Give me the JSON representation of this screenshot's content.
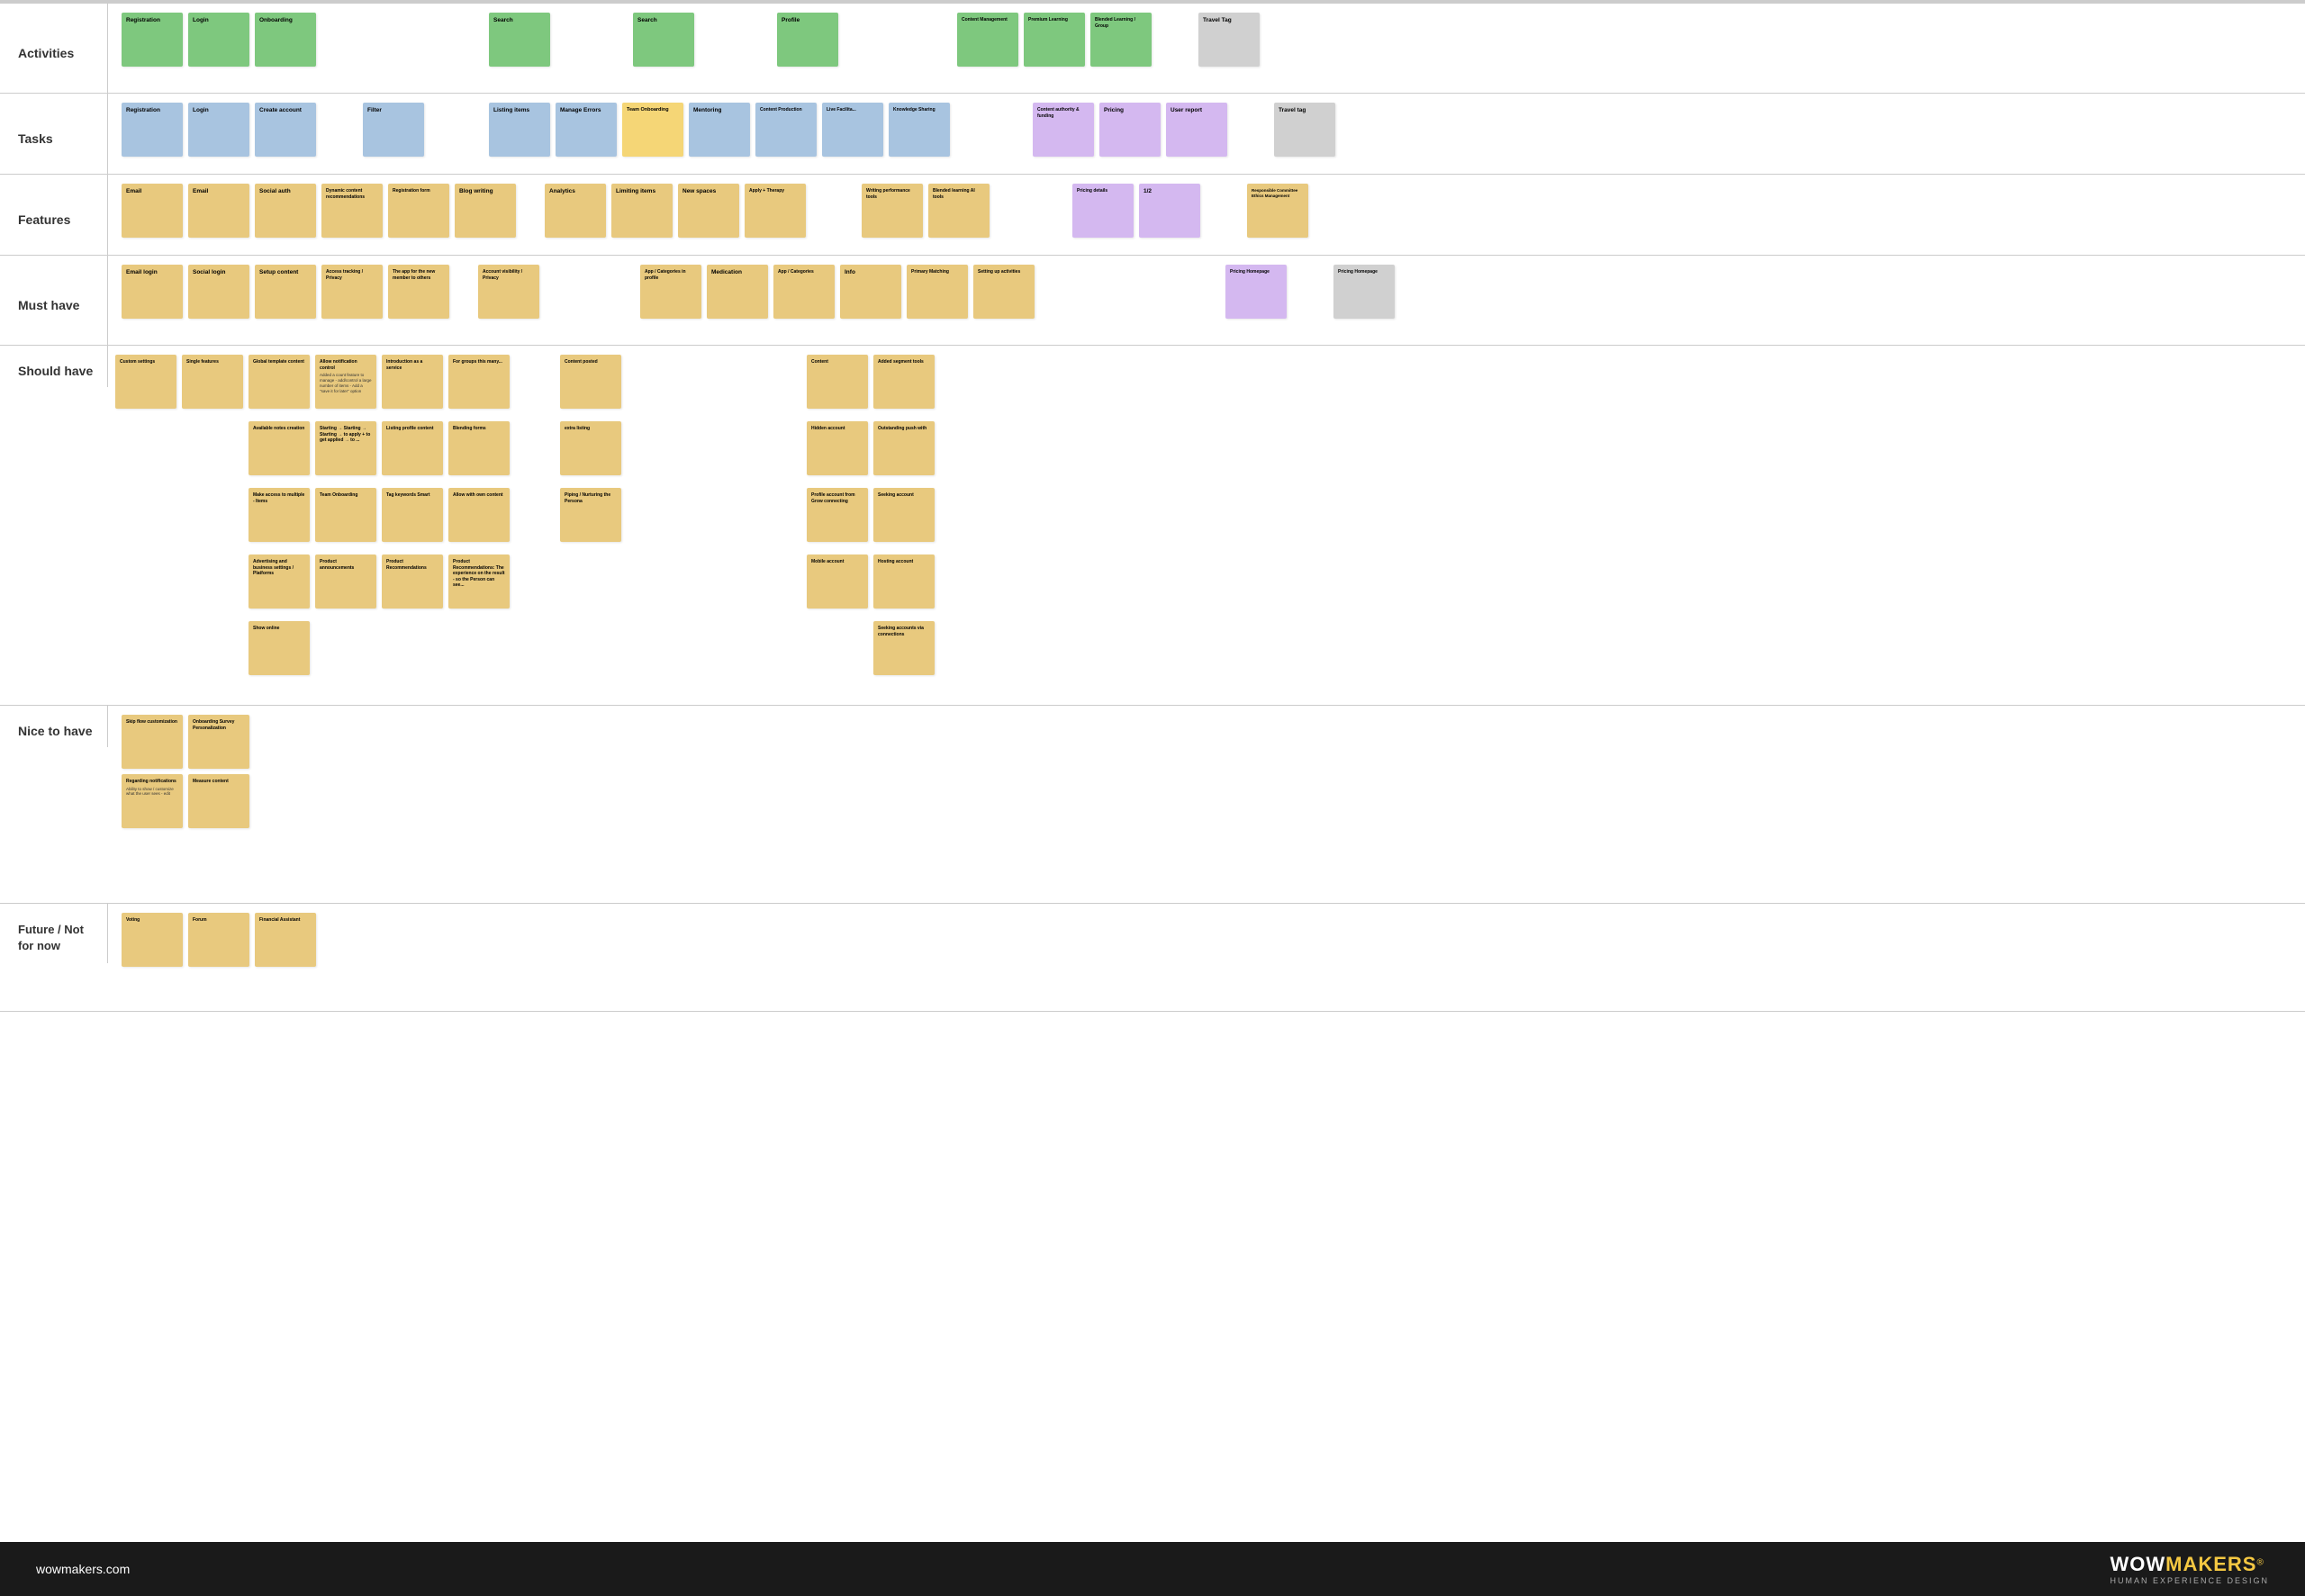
{
  "rows": [
    {
      "id": "activities",
      "label": "Activities",
      "notes": [
        {
          "color": "green",
          "title": "Registration",
          "tag": ""
        },
        {
          "color": "green",
          "title": "Login",
          "tag": ""
        },
        {
          "color": "green",
          "title": "Onboa...",
          "tag": ""
        },
        {
          "color": "",
          "title": "",
          "tag": ""
        },
        {
          "color": "",
          "title": "",
          "tag": ""
        },
        {
          "color": "",
          "title": "",
          "tag": ""
        },
        {
          "color": "",
          "title": "",
          "tag": ""
        },
        {
          "color": "",
          "title": "",
          "tag": ""
        },
        {
          "color": "green",
          "title": "Search",
          "tag": ""
        },
        {
          "color": "",
          "title": "",
          "tag": ""
        },
        {
          "color": "green",
          "title": "Search",
          "tag": ""
        },
        {
          "color": "",
          "title": "",
          "tag": ""
        },
        {
          "color": "green",
          "title": "Profile",
          "tag": ""
        },
        {
          "color": "",
          "title": "",
          "tag": ""
        },
        {
          "color": "",
          "title": "",
          "tag": ""
        },
        {
          "color": "green",
          "title": "Content Management",
          "tag": ""
        },
        {
          "color": "green",
          "title": "Premium Learning",
          "tag": ""
        },
        {
          "color": "green",
          "title": "Blended Learning / Group",
          "tag": ""
        },
        {
          "color": "",
          "title": "",
          "tag": ""
        },
        {
          "color": "gray",
          "title": "Travel Tag",
          "tag": ""
        }
      ]
    },
    {
      "id": "tasks",
      "label": "Tasks",
      "notes": [
        {
          "color": "blue",
          "title": "Registration",
          "tag": ""
        },
        {
          "color": "blue",
          "title": "Login",
          "tag": ""
        },
        {
          "color": "blue",
          "title": "Create account",
          "tag": ""
        },
        {
          "color": "",
          "title": "",
          "tag": ""
        },
        {
          "color": "blue",
          "title": "Filter",
          "tag": ""
        },
        {
          "color": "",
          "title": "",
          "tag": ""
        },
        {
          "color": "blue",
          "title": "Listing items",
          "tag": ""
        },
        {
          "color": "blue",
          "title": "Manage Errors",
          "tag": ""
        },
        {
          "color": "yellow",
          "title": "Team Onboarding",
          "tag": ""
        },
        {
          "color": "blue",
          "title": "Mentoring",
          "tag": ""
        },
        {
          "color": "blue",
          "title": "Content Production",
          "tag": ""
        },
        {
          "color": "blue",
          "title": "Live Facilita...",
          "tag": ""
        },
        {
          "color": "blue",
          "title": "Knowledge Sharing",
          "tag": ""
        },
        {
          "color": "",
          "title": "",
          "tag": ""
        },
        {
          "color": "purple",
          "title": "Content authority & funding",
          "tag": ""
        },
        {
          "color": "purple",
          "title": "Pricing",
          "tag": ""
        },
        {
          "color": "purple",
          "title": "User report",
          "tag": ""
        },
        {
          "color": "",
          "title": "",
          "tag": ""
        },
        {
          "color": "gray",
          "title": "Travel tag",
          "tag": ""
        }
      ]
    },
    {
      "id": "features",
      "label": "Features",
      "notes": [
        {
          "color": "yellow",
          "title": "Email",
          "tag": ""
        },
        {
          "color": "yellow",
          "title": "Email",
          "tag": ""
        },
        {
          "color": "yellow",
          "title": "Social auth",
          "tag": ""
        },
        {
          "color": "yellow",
          "title": "Dynamic content recommendations",
          "tag": ""
        },
        {
          "color": "yellow",
          "title": "Registration form",
          "tag": ""
        },
        {
          "color": "yellow",
          "title": "Blog writing",
          "tag": ""
        },
        {
          "color": "",
          "title": "",
          "tag": ""
        },
        {
          "color": "yellow",
          "title": "Analytics",
          "tag": ""
        },
        {
          "color": "yellow",
          "title": "Limiting items",
          "tag": ""
        },
        {
          "color": "yellow",
          "title": "New spaces",
          "tag": ""
        },
        {
          "color": "yellow",
          "title": "Apply + Therapy",
          "tag": ""
        },
        {
          "color": "",
          "title": "",
          "tag": ""
        },
        {
          "color": "yellow",
          "title": "Writing performance tools",
          "tag": ""
        },
        {
          "color": "yellow",
          "title": "Blended learning AI tools",
          "tag": ""
        },
        {
          "color": "",
          "title": "",
          "tag": ""
        },
        {
          "color": "purple",
          "title": "Pricing details",
          "tag": ""
        },
        {
          "color": "purple",
          "title": "1/2",
          "tag": ""
        },
        {
          "color": "",
          "title": "",
          "tag": ""
        },
        {
          "color": "yellow",
          "title": "Responsible Committee Ethics Management...",
          "tag": ""
        }
      ]
    },
    {
      "id": "musthave",
      "label": "Must have",
      "notes": [
        {
          "color": "yellow",
          "title": "Email login",
          "tag": ""
        },
        {
          "color": "yellow",
          "title": "Social login",
          "tag": ""
        },
        {
          "color": "yellow",
          "title": "Setup content",
          "tag": ""
        },
        {
          "color": "yellow",
          "title": "Access tracking / Privacy",
          "tag": ""
        },
        {
          "color": "yellow",
          "title": "The app for the new member to others",
          "tag": ""
        },
        {
          "color": "",
          "title": "",
          "tag": ""
        },
        {
          "color": "yellow",
          "title": "Account visibility / Privacy",
          "tag": ""
        },
        {
          "color": "",
          "title": "",
          "tag": ""
        },
        {
          "color": "",
          "title": "",
          "tag": ""
        },
        {
          "color": "yellow",
          "title": "App / Categories in profile",
          "tag": ""
        },
        {
          "color": "yellow",
          "title": "Medication",
          "tag": ""
        },
        {
          "color": "yellow",
          "title": "App / Categories",
          "tag": ""
        },
        {
          "color": "yellow",
          "title": "Info",
          "tag": ""
        },
        {
          "color": "yellow",
          "title": "Primary Matching",
          "tag": ""
        },
        {
          "color": "yellow",
          "title": "Setting up activities",
          "tag": ""
        },
        {
          "color": "",
          "title": "",
          "tag": ""
        },
        {
          "color": "",
          "title": "",
          "tag": ""
        },
        {
          "color": "purple",
          "title": "Pricing Homepage",
          "tag": ""
        },
        {
          "color": "",
          "title": "",
          "tag": ""
        },
        {
          "color": "gray",
          "title": "Pricing Homepage",
          "tag": ""
        }
      ]
    }
  ],
  "footer": {
    "url": "wowmakers.com",
    "logo_wow": "WOW",
    "logo_makers": "MAKERS",
    "logo_reg": "®",
    "logo_sub": "HUMAN EXPERIENCE DESIGN"
  }
}
